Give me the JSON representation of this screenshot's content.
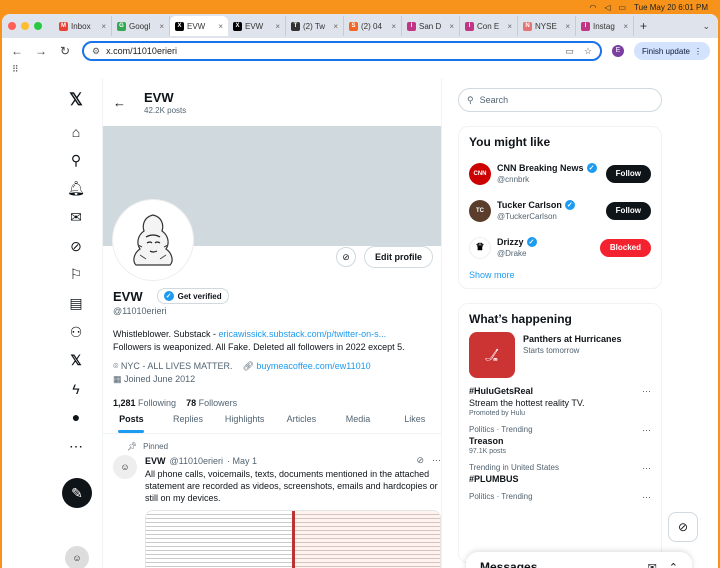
{
  "menubar": {
    "datetime": "Tue May 20  6:01 PM"
  },
  "browser": {
    "tabs": [
      {
        "label": "Inbox",
        "fav_color": "#ea4335",
        "fav_letter": "M"
      },
      {
        "label": "Googl",
        "fav_color": "#34a853",
        "fav_letter": "G"
      },
      {
        "label": "EVW",
        "fav_color": "#000000",
        "fav_letter": "X",
        "active": true
      },
      {
        "label": "EVW",
        "fav_color": "#000000",
        "fav_letter": "X"
      },
      {
        "label": "(2) Tw",
        "fav_color": "#333333",
        "fav_letter": "T"
      },
      {
        "label": "(2) 04",
        "fav_color": "#f26522",
        "fav_letter": "S"
      },
      {
        "label": "San D",
        "fav_color": "#c13584",
        "fav_letter": "I"
      },
      {
        "label": "Con E",
        "fav_color": "#c13584",
        "fav_letter": "I"
      },
      {
        "label": "NYSE",
        "fav_color": "#e57373",
        "fav_letter": "N"
      },
      {
        "label": "Instag",
        "fav_color": "#c13584",
        "fav_letter": "I"
      }
    ],
    "new_tab": "+",
    "url": "x.com/11010erieri",
    "finish_update": "Finish update",
    "profile_letter": "E"
  },
  "x_header": {
    "name": "EVW",
    "posts": "42.2K posts"
  },
  "profile": {
    "name": "EVW",
    "get_verified": "Get verified",
    "handle": "@11010erieri",
    "edit_profile": "Edit profile",
    "bio_line1_text": "Whistleblower. Substack - ",
    "bio_link": "ericawissick.substack.com/p/twitter-on-s...",
    "bio_line2": "Followers is weaponized. All Fake. Deleted all followers in 2022 except 5.",
    "location": "NYC - ALL LIVES MATTER.",
    "website": "buymeacoffee.com/ew11010",
    "joined": "Joined June 2012",
    "following_count": "1,281",
    "following_label": "Following",
    "followers_count": "78",
    "followers_label": "Followers"
  },
  "profile_tabs": [
    "Posts",
    "Replies",
    "Highlights",
    "Articles",
    "Media",
    "Likes"
  ],
  "pinned_tweet": {
    "pinned_label": "Pinned",
    "name": "EVW",
    "handle": "@11010erieri",
    "date": "· May 1",
    "text": "All phone calls, voicemails, texts, documents mentioned in the attached statement are recorded as videos, screenshots, emails and hardcopies or still on my devices."
  },
  "search": {
    "placeholder": "Search"
  },
  "you_might_like": {
    "title": "You might like",
    "items": [
      {
        "name": "CNN Breaking News",
        "handle": "@cnnbrk",
        "action": "Follow",
        "avatar_color": "#cc0000",
        "avatar_text": "CNN"
      },
      {
        "name": "Tucker Carlson",
        "handle": "@TuckerCarlson",
        "action": "Follow",
        "avatar_color": "#5a3e2b",
        "avatar_text": "TC"
      },
      {
        "name": "Drizzy",
        "handle": "@Drake",
        "action": "Blocked",
        "avatar_color": "#ffffff",
        "avatar_text": "♛"
      }
    ],
    "show_more": "Show more"
  },
  "whats_happening": {
    "title": "What’s happening",
    "featured": {
      "title": "Panthers at Hurricanes",
      "subtitle": "Starts tomorrow"
    },
    "trends": [
      {
        "context": "",
        "name": "#HuluGetsReal",
        "desc": "Stream the hottest reality TV.",
        "note": "Promoted by Hulu"
      },
      {
        "context": "Politics · Trending",
        "name": "Treason",
        "desc": "",
        "note": "97.1K posts"
      },
      {
        "context": "Trending in United States",
        "name": "#PLUMBUS",
        "desc": "",
        "note": ""
      },
      {
        "context": "Politics · Trending",
        "name": "",
        "desc": "",
        "note": ""
      }
    ]
  },
  "messages": {
    "title": "Messages"
  },
  "colors": {
    "x_blue": "#1d9bf0",
    "blocked_red": "#f4212e",
    "menubar_orange": "#f7931a"
  }
}
